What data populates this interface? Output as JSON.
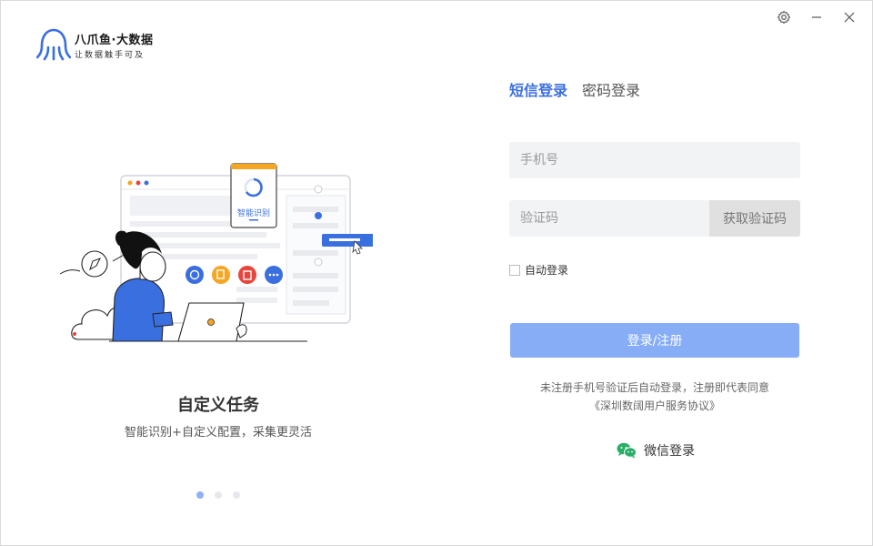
{
  "brand": {
    "name": "八爪鱼·大数据",
    "slogan": "让数据触手可及",
    "color": "#3a6fe0"
  },
  "window_controls": {
    "settings_icon": "gear-icon",
    "minimize_icon": "minimize-icon",
    "close_icon": "close-icon"
  },
  "slide": {
    "illustration_label": "智能识别",
    "title": "自定义任务",
    "description": "智能识别+自定义配置，采集更灵活",
    "active_index": 0,
    "count": 3
  },
  "login": {
    "tabs": [
      {
        "label": "短信登录",
        "active": true
      },
      {
        "label": "密码登录",
        "active": false
      }
    ],
    "phone_placeholder": "手机号",
    "code_placeholder": "验证码",
    "get_code_label": "获取验证码",
    "auto_login_label": "自动登录",
    "auto_login_checked": false,
    "submit_label": "登录/注册",
    "notice_line1": "未注册手机号验证后自动登录，注册即代表同意",
    "notice_line2": "《深圳数阔用户服务协议》",
    "wechat_label": "微信登录"
  },
  "colors": {
    "accent": "#3a6fe0",
    "submit_bg": "#86adf5",
    "field_bg": "#f2f3f5",
    "wechat": "#2aae67"
  }
}
